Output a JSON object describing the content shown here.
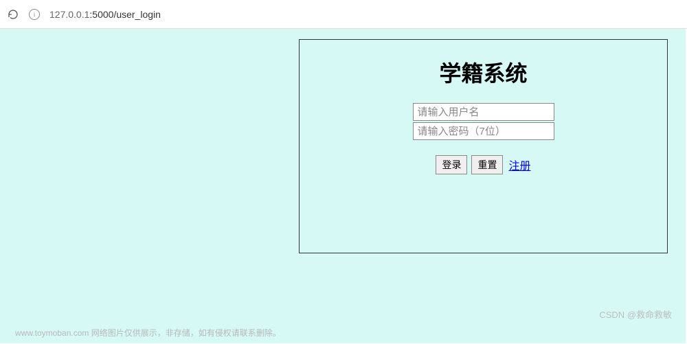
{
  "browser": {
    "url_host": "127.0.0.1",
    "url_port": ":5000",
    "url_path": "/user_login",
    "info_label": "i"
  },
  "login": {
    "title": "学籍系统",
    "username_placeholder": "请输入用户名",
    "password_placeholder": "请输入密码（7位）",
    "login_button": "登录",
    "reset_button": "重置",
    "register_link": "注册"
  },
  "watermark": {
    "bottom_left": "www.toymoban.com 网络图片仅供展示，非存储，如有侵权请联系删除。",
    "bottom_right": "CSDN @救命救敏"
  }
}
